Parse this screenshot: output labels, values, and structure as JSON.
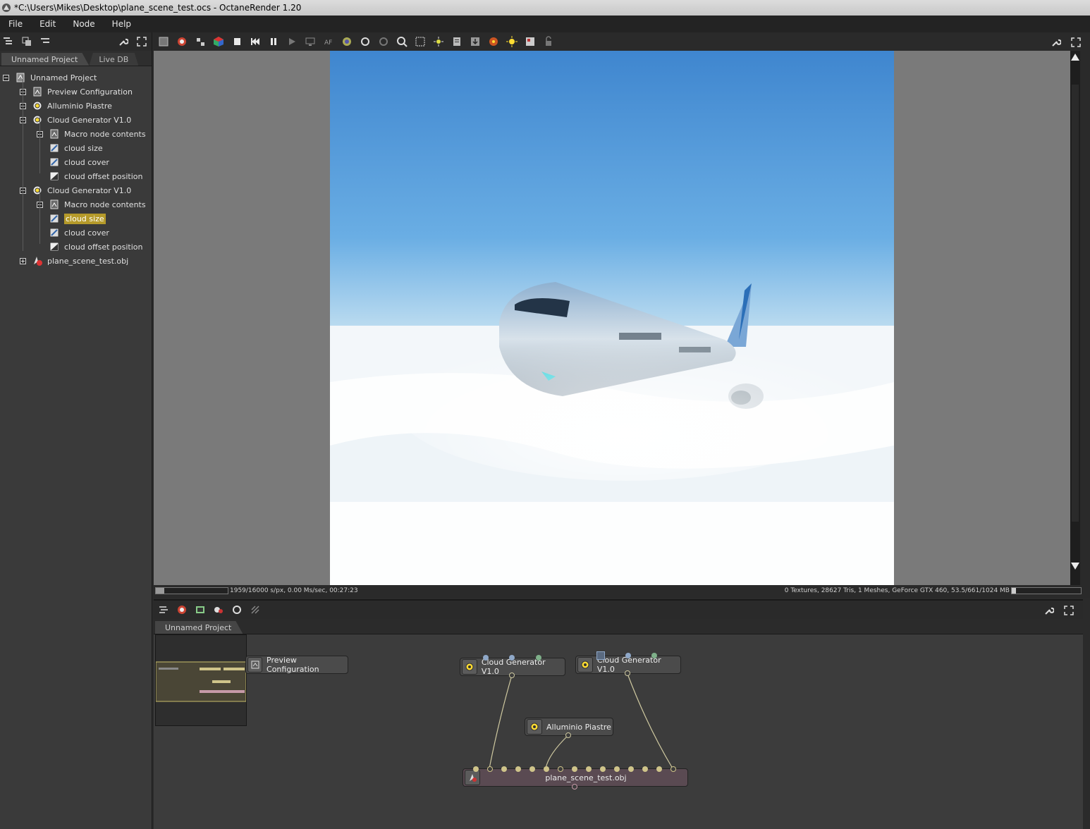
{
  "window": {
    "title": "*C:\\Users\\Mikes\\Desktop\\plane_scene_test.ocs - OctaneRender 1.20"
  },
  "menu": [
    "File",
    "Edit",
    "Node",
    "Help"
  ],
  "scene_outliner": {
    "tabs": [
      "Unnamed Project",
      "Live DB"
    ],
    "tree": [
      {
        "label": "Unnamed Project",
        "icon": "project-icon",
        "expander": "minus",
        "level": 0
      },
      {
        "label": "Preview Configuration",
        "icon": "macro-node-icon",
        "expander": "plus",
        "level": 1
      },
      {
        "label": "Alluminio Piastre",
        "icon": "material-icon",
        "expander": "plus",
        "level": 1
      },
      {
        "label": "Cloud Generator V1.0",
        "icon": "material-icon",
        "expander": "minus",
        "level": 1
      },
      {
        "label": "Macro node contents",
        "icon": "macro-node-icon",
        "expander": "plus",
        "level": 2
      },
      {
        "label": "cloud size",
        "icon": "float-value-icon",
        "expander": "",
        "level": 2
      },
      {
        "label": "cloud cover",
        "icon": "float-value-icon",
        "expander": "",
        "level": 2
      },
      {
        "label": "cloud offset position",
        "icon": "transform-icon",
        "expander": "",
        "level": 2
      },
      {
        "label": "Cloud Generator V1.0",
        "icon": "material-icon",
        "expander": "minus",
        "level": 1
      },
      {
        "label": "Macro node contents",
        "icon": "macro-node-icon",
        "expander": "plus",
        "level": 2
      },
      {
        "label": "cloud size",
        "icon": "float-value-icon",
        "expander": "",
        "level": 2,
        "selected": true
      },
      {
        "label": "cloud cover",
        "icon": "float-value-icon",
        "expander": "",
        "level": 2
      },
      {
        "label": "cloud offset position",
        "icon": "transform-icon",
        "expander": "",
        "level": 2
      },
      {
        "label": "plane_scene_test.obj",
        "icon": "mesh-icon",
        "expander": "plus",
        "level": 1
      }
    ]
  },
  "render_viewport": {
    "status_left": "1959/16000 s/px, 0.00 Ms/sec, 00:27:23",
    "status_right": "0 Textures, 28627 Tris, 1 Meshes, GeForce GTX 460, 53.5/661/1024 MB",
    "progress": 0.12,
    "memory_progress": 0.06
  },
  "node_graph": {
    "tab": "Unnamed Project",
    "nodes": {
      "preview": "Preview Configuration",
      "cloud1": "Cloud Generator V1.0",
      "cloud2": "Cloud Generator V1.0",
      "alluminio": "Alluminio Piastre",
      "mesh": "plane_scene_test.obj"
    }
  },
  "colors": {
    "selection": "#b59a2a",
    "pin_blue": "#8fa8c8",
    "pin_green": "#7fb08a",
    "pin_tan": "#cfc48a",
    "wire": "#cfc9a0"
  }
}
